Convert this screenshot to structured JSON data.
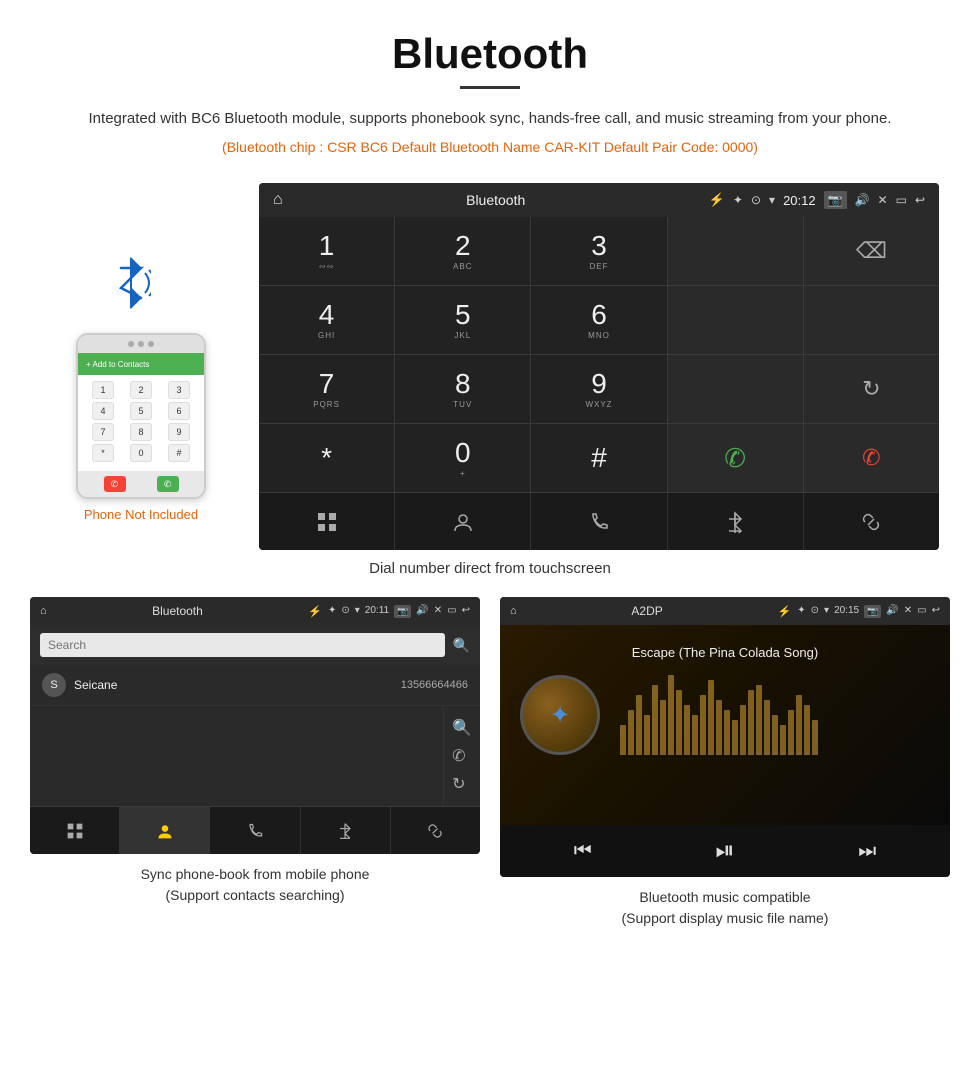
{
  "header": {
    "title": "Bluetooth",
    "description": "Integrated with BC6 Bluetooth module, supports phonebook sync, hands-free call, and music streaming from your phone.",
    "specs": "(Bluetooth chip : CSR BC6    Default Bluetooth Name CAR-KIT    Default Pair Code: 0000)"
  },
  "phone_label": "Phone Not Included",
  "main_screen": {
    "title": "Bluetooth",
    "time": "20:12",
    "keys": [
      {
        "num": "1",
        "sub": ""
      },
      {
        "num": "2",
        "sub": "ABC"
      },
      {
        "num": "3",
        "sub": "DEF"
      },
      {
        "num": "",
        "sub": ""
      },
      {
        "num": "⌫",
        "sub": ""
      },
      {
        "num": "4",
        "sub": "GHI"
      },
      {
        "num": "5",
        "sub": "JKL"
      },
      {
        "num": "6",
        "sub": "MNO"
      },
      {
        "num": "",
        "sub": ""
      },
      {
        "num": "",
        "sub": ""
      },
      {
        "num": "7",
        "sub": "PQRS"
      },
      {
        "num": "8",
        "sub": "TUV"
      },
      {
        "num": "9",
        "sub": "WXYZ"
      },
      {
        "num": "",
        "sub": ""
      },
      {
        "num": "↻",
        "sub": ""
      },
      {
        "num": "*",
        "sub": ""
      },
      {
        "num": "0",
        "sub": "+"
      },
      {
        "num": "#",
        "sub": ""
      },
      {
        "num": "📞",
        "sub": ""
      },
      {
        "num": "📵",
        "sub": ""
      }
    ]
  },
  "main_caption": "Dial number direct from touchscreen",
  "phonebook_screen": {
    "title": "Bluetooth",
    "time": "20:11",
    "search_placeholder": "Search",
    "contact": {
      "letter": "S",
      "name": "Seicane",
      "number": "13566664466"
    }
  },
  "phonebook_caption": "Sync phone-book from mobile phone\n(Support contacts searching)",
  "music_screen": {
    "title": "A2DP",
    "time": "20:15",
    "song": "Escape (The Pina Colada Song)",
    "eq_bars": [
      30,
      45,
      60,
      40,
      70,
      55,
      80,
      65,
      50,
      40,
      60,
      75,
      55,
      45,
      35,
      50,
      65,
      70,
      55,
      40,
      30,
      45,
      60,
      50,
      35
    ]
  },
  "music_caption": "Bluetooth music compatible\n(Support display music file name)"
}
